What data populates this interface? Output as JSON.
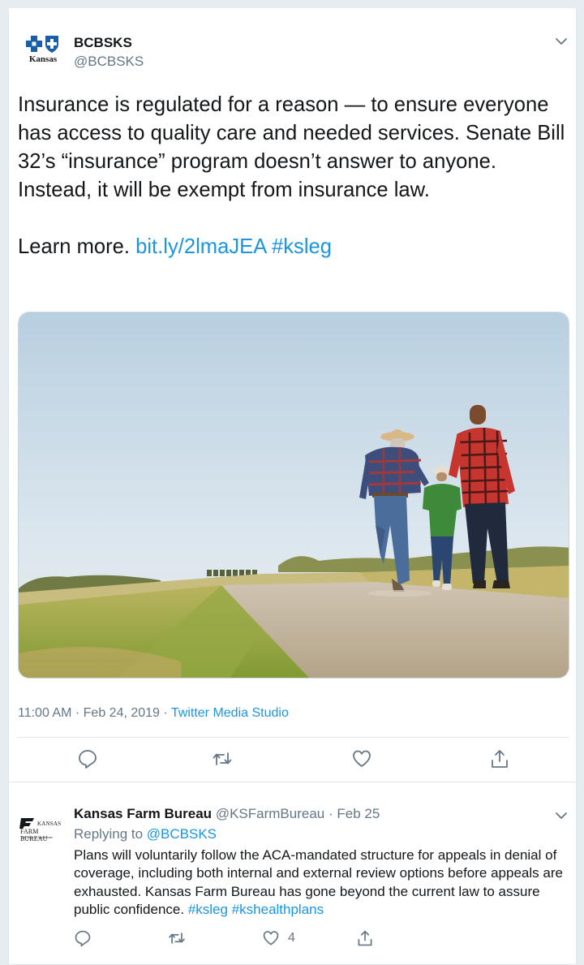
{
  "tweet": {
    "author_name": "BCBSKS",
    "author_handle": "@BCBSKS",
    "logo_text": "Kansas",
    "text_main": "Insurance is regulated for a reason — to ensure everyone has access to quality care and needed services. Senate Bill 32’s “insurance” program doesn’t answer to anyone. Instead, it will be exempt from insurance law.",
    "text_learn": "Learn more.",
    "link": "bit.ly/2lmaJEA",
    "hashtag": "#ksleg",
    "time": "11:00 AM",
    "date": "Feb 24, 2019",
    "meta_sep": "·",
    "source": "Twitter Media Studio"
  },
  "reply": {
    "author_name": "Kansas Farm Bureau",
    "author_handle": "@KSFarmBureau",
    "sep": "·",
    "date": "Feb 25",
    "replying_prefix": "Replying to",
    "replying_to": "@BCBSKS",
    "text": "Plans will voluntarily follow the ACA-mandated structure for appeals in denial of coverage, including both internal and external review options before appeals are exhausted. Kansas Farm Bureau has gone beyond the current law to assure public confidence.",
    "hashtag1": "#ksleg",
    "hashtag2": "#kshealthplans",
    "like_count": "4",
    "logo_line1": "KANSAS",
    "logo_line2": "FARM BUREAU",
    "logo_line3": "The Voice of Agriculture"
  },
  "colors": {
    "link": "#1b95e0",
    "muted": "#657786",
    "text": "#14171a",
    "divider": "#e1e8ed",
    "background": "#e6ecf0"
  },
  "icons": [
    "chevron-down-icon",
    "reply-icon",
    "retweet-icon",
    "like-icon",
    "share-icon"
  ]
}
